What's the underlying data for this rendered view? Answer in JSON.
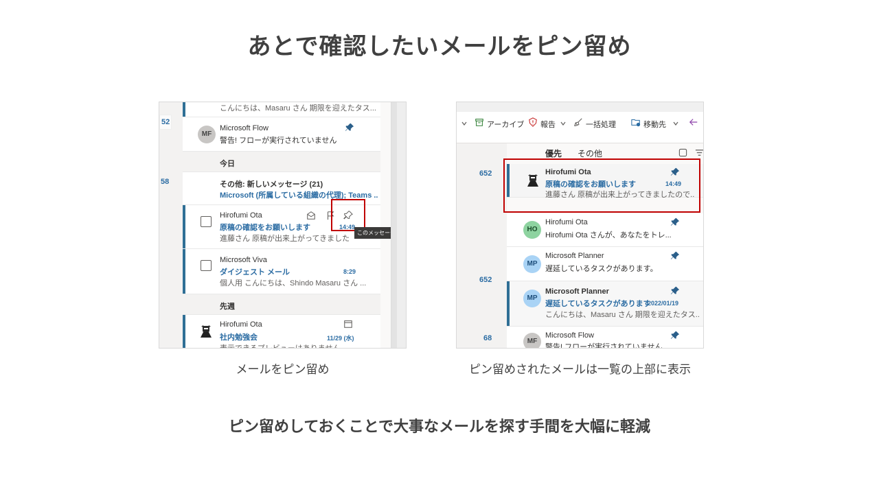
{
  "slide": {
    "title": "あとで確認したいメールをピン留め",
    "caption_left": "メールをピン留め",
    "caption_right": "ピン留めされたメールは一覧の上部に表示",
    "footer": "ピン留めしておくことで大事なメールを探す手間を大幅に軽減"
  },
  "left": {
    "gutter": [
      "52",
      "58"
    ],
    "top_preview": "こんにちは、Masaru さん 期限を迎えたタス...",
    "flow": {
      "avatar": "MF",
      "sender": "Microsoft Flow",
      "subject": "警告! フローが実行されていません"
    },
    "section_today": "今日",
    "other": {
      "title": "その他: 新しいメッセージ (21)",
      "subject": "Microsoft (所属している組織の代理); Teams ..."
    },
    "hirofumi": {
      "sender": "Hirofumi Ota",
      "subject": "原稿の確認をお願いします",
      "time": "14:49",
      "preview": "進藤さん 原稿が出来上がってきましたので..."
    },
    "tooltip": "このメッセージを常に上部にピン留めする",
    "viva": {
      "sender": "Microsoft Viva",
      "subject": "ダイジェスト メール",
      "time": "8:29",
      "preview": "個人用 こんにちは、Shindo Masaru さん ..."
    },
    "section_lastweek": "先週",
    "study": {
      "sender": "Hirofumi Ota",
      "subject": "社内勉強会",
      "time": "11/29 (水)",
      "preview": "表示できるプレビューはありません。"
    }
  },
  "right": {
    "toolbar": {
      "archive": "アーカイブ",
      "report": "報告",
      "sweep": "一括処理",
      "move": "移動先"
    },
    "folder_counts": [
      "652",
      "652",
      "68"
    ],
    "tabs": {
      "focused": "優先",
      "other": "その他"
    },
    "messages": [
      {
        "sender": "Hirofumi Ota",
        "subject": "原稿の確認をお願いします",
        "time": "14:49",
        "preview": "進藤さん 原稿が出来上がってきましたので..."
      },
      {
        "avatar": "HO",
        "sender": "Hirofumi Ota",
        "subject": "Hirofumi Ota さんが、あなたをトレ..."
      },
      {
        "avatar": "MP",
        "sender": "Microsoft Planner",
        "subject": "遅延しているタスクがあります。"
      },
      {
        "avatar": "MP",
        "sender": "Microsoft Planner",
        "subject": "遅延しているタスクがあります。",
        "time": "2022/01/19",
        "preview": "こんにちは、Masaru さん 期限を迎えたタス..."
      },
      {
        "avatar": "MF",
        "sender": "Microsoft Flow",
        "subject": "警告! フローが実行されていません"
      }
    ]
  }
}
